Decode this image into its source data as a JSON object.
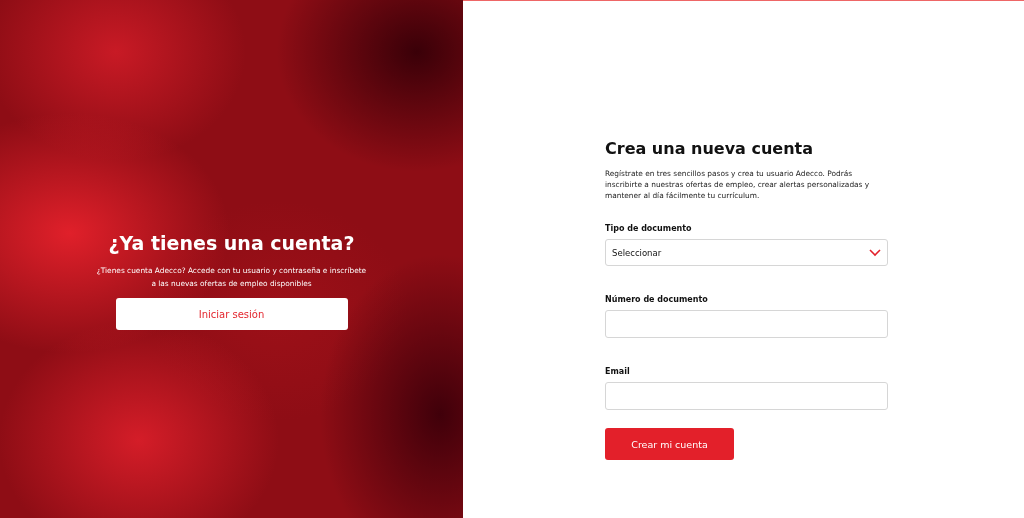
{
  "login_panel": {
    "title": "¿Ya tienes una cuenta?",
    "text": "¿Tienes cuenta Adecco? Accede con tu usuario y contraseña e inscríbete a las nuevas ofertas de empleo disponibles",
    "button": "Iniciar sesión"
  },
  "register_form": {
    "title": "Crea una nueva cuenta",
    "intro": "Regístrate en tres sencillos pasos y crea tu usuario Adecco. Podrás inscribirte a nuestras ofertas de empleo, crear alertas personalizadas y mantener al día fácilmente tu currículum.",
    "fields": [
      {
        "kind": "select",
        "label": "Tipo de documento",
        "value": "Seleccionar"
      },
      {
        "kind": "text",
        "label": "Número de documento"
      },
      {
        "kind": "text",
        "label": "Email"
      }
    ],
    "submit": "Crear mi cuenta"
  }
}
